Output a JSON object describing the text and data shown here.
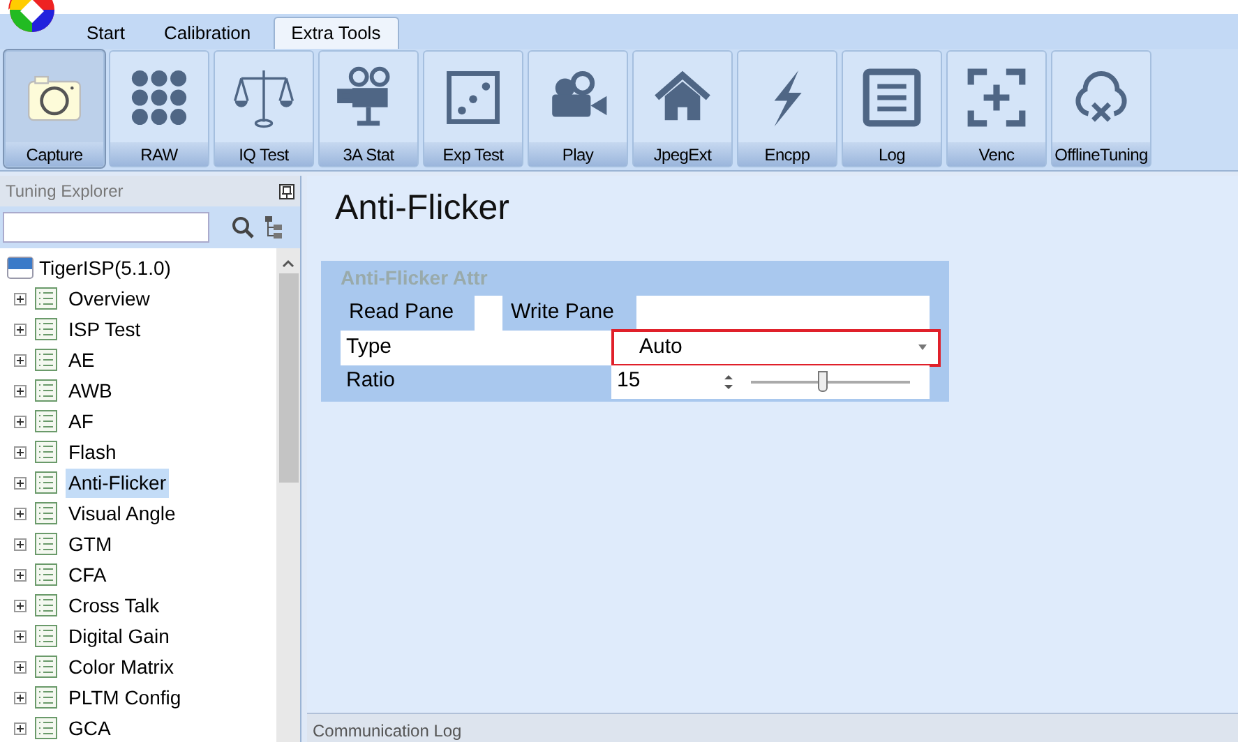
{
  "tabs": [
    {
      "label": "Start",
      "selected": false
    },
    {
      "label": "Calibration",
      "selected": false
    },
    {
      "label": "Extra Tools",
      "selected": true
    }
  ],
  "ribbon": [
    {
      "label": "Capture",
      "kind": "camera",
      "selected": true
    },
    {
      "label": "RAW",
      "kind": "dots",
      "selected": false
    },
    {
      "label": "IQ Test",
      "kind": "scale",
      "selected": false
    },
    {
      "label": "3A Stat",
      "kind": "projector",
      "selected": false
    },
    {
      "label": "Exp Test",
      "kind": "dice",
      "selected": false
    },
    {
      "label": "Play",
      "kind": "video",
      "selected": false
    },
    {
      "label": "JpegExt",
      "kind": "house",
      "selected": false
    },
    {
      "label": "Encpp",
      "kind": "bolt",
      "selected": false
    },
    {
      "label": "Log",
      "kind": "list",
      "selected": false
    },
    {
      "label": "Venc",
      "kind": "plus",
      "selected": false
    },
    {
      "label": "OfflineTuning",
      "kind": "cloud",
      "selected": false
    }
  ],
  "explorer": {
    "title": "Tuning Explorer",
    "root": "TigerISP(5.1.0)",
    "items": [
      {
        "label": "Overview",
        "selected": false
      },
      {
        "label": "ISP Test",
        "selected": false
      },
      {
        "label": "AE",
        "selected": false
      },
      {
        "label": "AWB",
        "selected": false
      },
      {
        "label": "AF",
        "selected": false
      },
      {
        "label": "Flash",
        "selected": false
      },
      {
        "label": "Anti-Flicker",
        "selected": true
      },
      {
        "label": "Visual Angle",
        "selected": false
      },
      {
        "label": "GTM",
        "selected": false
      },
      {
        "label": "CFA",
        "selected": false
      },
      {
        "label": "Cross Talk",
        "selected": false
      },
      {
        "label": "Digital Gain",
        "selected": false
      },
      {
        "label": "Color Matrix",
        "selected": false
      },
      {
        "label": "PLTM Config",
        "selected": false
      },
      {
        "label": "GCA",
        "selected": false
      }
    ]
  },
  "page": {
    "title": "Anti-Flicker",
    "group": "Anti-Flicker Attr",
    "panes": [
      "Read Pane",
      "Write Pane"
    ],
    "type": {
      "label": "Type",
      "value": "Auto"
    },
    "ratio": {
      "label": "Ratio",
      "value": "15",
      "level": 0.45
    }
  },
  "status_bar": "Communication Log"
}
